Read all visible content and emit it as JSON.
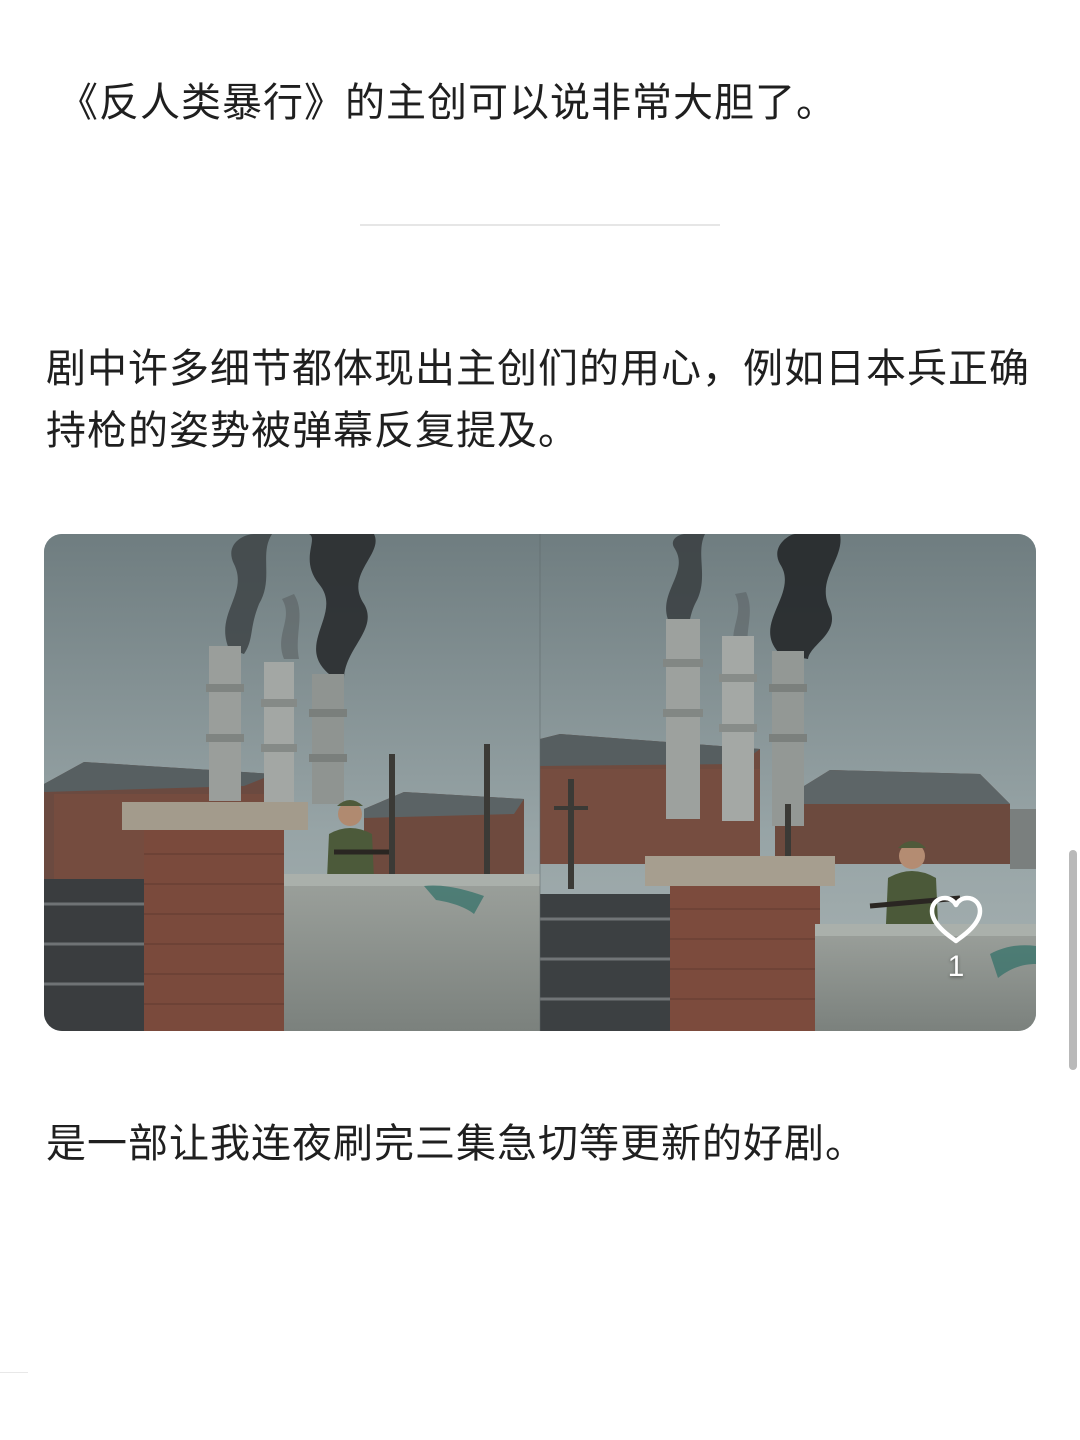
{
  "post": {
    "paragraph_1": "《反人类暴行》的主创可以说非常大胆了。",
    "paragraph_2": "剧中许多细节都体现出主创们的用心，例如日本兵正确持枪的姿势被弹幕反复提及。",
    "paragraph_3": "是一部让我连夜刷完三集急切等更新的好剧。"
  },
  "image": {
    "like_icon": "heart-outline-icon",
    "like_count": "1",
    "panels": [
      "left-frame",
      "right-frame"
    ]
  },
  "colors": {
    "text": "#1f1f1f",
    "divider": "#e6e6e6",
    "sky": "#8b999b",
    "smoke": "#2c2f31",
    "brick": "#7a4a3c",
    "concrete": "#8f9591",
    "like": "#ffffff"
  }
}
